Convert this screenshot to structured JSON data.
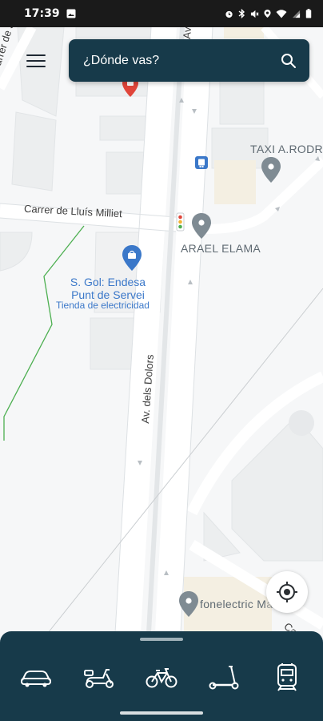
{
  "status_bar": {
    "time": "17:39"
  },
  "search": {
    "placeholder": "¿Dónde vas?"
  },
  "map": {
    "streets": {
      "joana": "Carrer de Joana",
      "lluis_milliet": "Carrer de Lluís Milliet",
      "dolors": "Av. dels Dolors",
      "av_top": "Av",
      "carrer_right": "Carrer"
    },
    "pois": {
      "endesa_line1": "S. Gol: Endesa",
      "endesa_line2": "Punt de Servei",
      "endesa_category": "Tienda de electricidad",
      "taxi": "TAXI A.RODR",
      "arael": "ARAEL ELAMA",
      "fonelectric": "fonelectric M",
      "fonelectric_tail": "a"
    }
  },
  "transport_modes": [
    "car-icon",
    "scooter-icon",
    "bicycle-icon",
    "kick-scooter-icon",
    "train-icon"
  ],
  "colors": {
    "primary": "#173a4a",
    "poi_blue": "#3b78c9",
    "pin_gray": "#7f8b93",
    "pin_red": "#e0453a"
  }
}
